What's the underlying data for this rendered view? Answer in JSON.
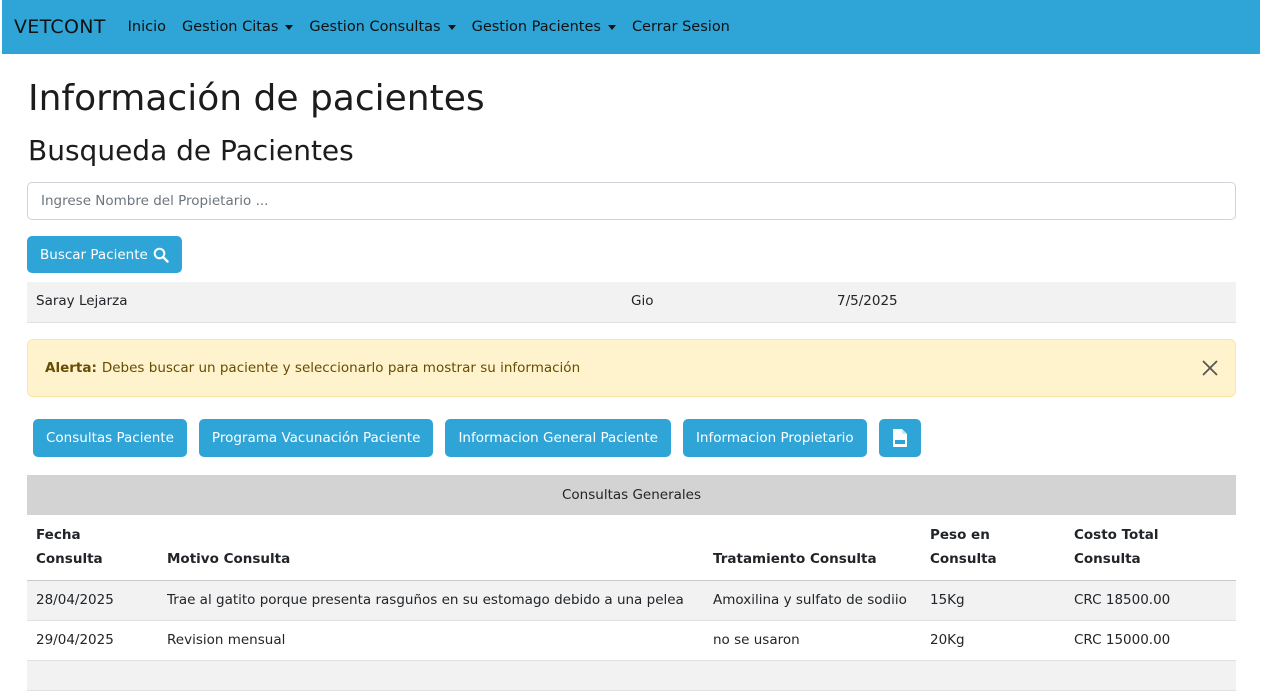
{
  "navbar": {
    "brand": "VETCONT",
    "items": [
      {
        "label": "Inicio",
        "dropdown": false
      },
      {
        "label": "Gestion Citas",
        "dropdown": true
      },
      {
        "label": "Gestion Consultas",
        "dropdown": true
      },
      {
        "label": "Gestion Pacientes",
        "dropdown": true
      },
      {
        "label": "Cerrar Sesion",
        "dropdown": false
      }
    ],
    "color": "#2fa4d7"
  },
  "page": {
    "title": "Información de pacientes",
    "subtitle": "Busqueda de Pacientes"
  },
  "search": {
    "placeholder": "Ingrese Nombre del Propietario ...",
    "value": "",
    "button_label": "Buscar Paciente",
    "button_icon": "search-icon"
  },
  "result": {
    "owner": "Saray Lejarza",
    "pet": "Gio",
    "date": "7/5/2025"
  },
  "alert": {
    "label": "Alerta:",
    "message": "Debes buscar un paciente y seleccionarlo para mostrar su información",
    "close_icon": "close-icon",
    "color": "#fff3cd"
  },
  "actions": {
    "consultas": "Consultas Paciente",
    "vacunacion": "Programa Vacunación Paciente",
    "general": "Informacion General Paciente",
    "propietario": "Informacion Propietario",
    "pdf_icon": "pdf-file-icon"
  },
  "consultas": {
    "title": "Consultas Generales",
    "columns": [
      "Fecha Consulta",
      "Motivo Consulta",
      "Tratamiento Consulta",
      "Peso en Consulta",
      "Costo Total Consulta"
    ],
    "rows": [
      [
        "28/04/2025",
        "Trae al gatito porque presenta rasguños en su estomago debido a una pelea",
        "Amoxilina y sulfato de sodiio",
        "15Kg",
        "CRC 18500.00"
      ],
      [
        "29/04/2025",
        "Revision mensual",
        "no se usaron",
        "20Kg",
        "CRC 15000.00"
      ]
    ]
  }
}
